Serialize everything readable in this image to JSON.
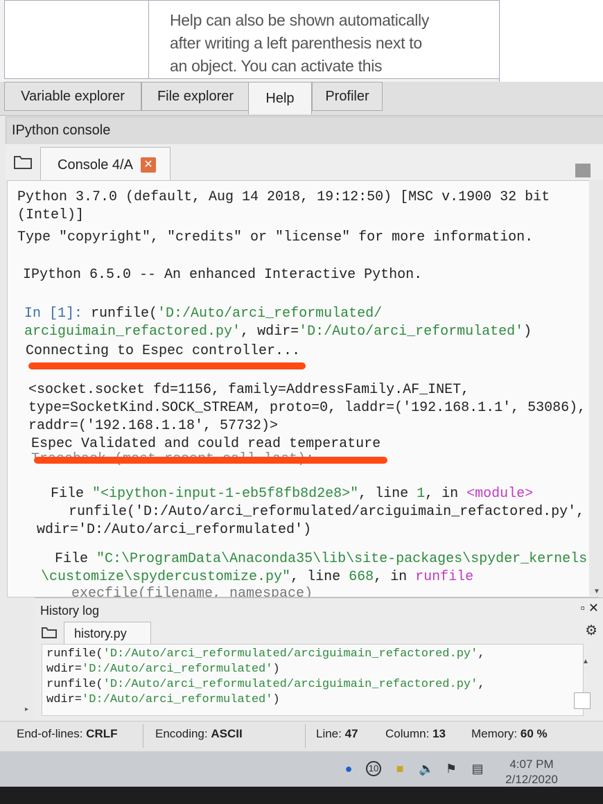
{
  "help": {
    "lines": [
      "Help can also be shown automatically",
      "after writing a left parenthesis next to",
      "an object. You can activate this"
    ]
  },
  "pane_tabs": [
    "Variable explorer",
    "File explorer",
    "Help",
    "Profiler"
  ],
  "ipython": {
    "title": "IPython console",
    "tab_label": "Console 4/A",
    "close_glyph": "✕"
  },
  "console": {
    "l1": "Python 3.7.0 (default, Aug 14 2018, 19:12:50) [MSC v.1900 32 bit",
    "l2": "(Intel)]",
    "l3": "Type \"copyright\", \"credits\" or \"license\" for more information.",
    "l4": "IPython 6.5.0 -- An enhanced Interactive Python.",
    "in_prompt": "In [1]: ",
    "in_call": "runfile(",
    "in_path1": "'D:/Auto/arci_reformulated/",
    "in_path2": "arciguimain_refactored.py'",
    "in_wdir_key": ", wdir=",
    "in_wdir_val": "'D:/Auto/arci_reformulated'",
    "in_close": ")",
    "connecting": "Connecting to Espec controller...",
    "sock1": "<socket.socket fd=1156, family=AddressFamily.AF_INET,",
    "sock2": "type=SocketKind.SOCK_STREAM, proto=0, laddr=('192.168.1.1', 53086),",
    "sock3": "raddr=('192.168.1.18', 57732)>",
    "validated": "Espec Validated and could read temperature",
    "traceback": "Traceback (most recent call last):",
    "f1_kw": "File ",
    "f1_name": "\"<ipython-input-1-eb5f8fb8d2e8>\"",
    "f1_line": ", line ",
    "f1_num": "1",
    "f1_in": ", in ",
    "f1_mod": "<module>",
    "f1_code1": "runfile('D:/Auto/arci_reformulated/arciguimain_refactored.py',",
    "f1_code2": "wdir='D:/Auto/arci_reformulated')",
    "f2_kw": "File ",
    "f2_name1": "\"C:\\ProgramData\\Anaconda35\\lib\\site-packages\\spyder_kernels",
    "f2_name2": "\\customize\\spydercustomize.py\"",
    "f2_line": ", line ",
    "f2_num": "668",
    "f2_in": ", in ",
    "f2_fn": "runfile",
    "f2_code": "execfile(filename, namespace)"
  },
  "history": {
    "title": "History log",
    "controls": "▫ ✕",
    "tab_label": "history.py",
    "h1a": "runfile(",
    "h1b": "'D:/Auto/arci_reformulated/arciguimain_refactored.py'",
    "h1c": ",",
    "h2a": "wdir=",
    "h2b": "'D:/Auto/arci_reformulated'",
    "h2c": ")",
    "h3a": "runfile(",
    "h3b": "'D:/Auto/arci_reformulated/arciguimain_refactored.py'",
    "h3c": ",",
    "h4a": "wdir=",
    "h4b": "'D:/Auto/arci_reformulated'",
    "h4c": ")"
  },
  "status": {
    "eol_label": "End-of-lines:",
    "eol_value": "CRLF",
    "enc_label": "Encoding:",
    "enc_value": "ASCII",
    "line_label": "Line:",
    "line_value": "47",
    "col_label": "Column:",
    "col_value": "13",
    "mem_label": "Memory:",
    "mem_value": "60 %"
  },
  "taskbar": {
    "time": "4:07 PM",
    "date": "2/12/2020"
  },
  "colors": {
    "highlight_line": "#ff4a14",
    "string_green": "#2e8b3e",
    "prompt_blue": "#3b6fa8",
    "keyword_magenta": "#c23ac2"
  }
}
